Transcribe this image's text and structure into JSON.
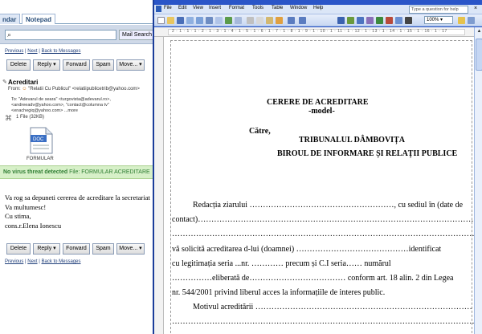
{
  "mail": {
    "tabs": [
      "ndar",
      "Notepad"
    ],
    "search": {
      "placeholder": "",
      "button_label": "Mail Search"
    },
    "links_top": [
      "Previous",
      "Next",
      "Back to Messages"
    ],
    "links_bottom": [
      "Previous",
      "Next",
      "Back to Messages"
    ],
    "actions": [
      "Delete",
      "Reply",
      "Forward",
      "Spam",
      "Move..."
    ],
    "message": {
      "subject": "Acreditari",
      "from_label": "From:",
      "from_value": "\"Relatii Cu Publicul\" <relatiipublicetrib@yahoo.com>",
      "to_label": "To:",
      "to_lines": [
        "\"Adevarul de seara\" <turgovista@adevarul.ro>, ",
        "<andreeadv@yahoo.com>, \"contact@columna tv\" ",
        "<enachegiq@yahoo.com> ...more"
      ],
      "to_more": "more",
      "attachment": "1 File (32KB)",
      "file_label": "FORMULAR",
      "virus_text_bold": "No virus threat detected",
      "virus_text_rest": " File: FORMULAR ACREDITARE",
      "body_lines": [
        "Va rog sa depuneti cererea de acreditare la secretariat",
        "Va multumesc!",
        "Cu stima,",
        "cons.r.Elena Ionescu"
      ]
    }
  },
  "word": {
    "menu": [
      "File",
      "Edit",
      "View",
      "Insert",
      "Format",
      "Tools",
      "Table",
      "Window",
      "Help"
    ],
    "ask_placeholder": "Type a question for help",
    "zoom": "100%",
    "ruler_numbers": "2 · 1 · 1 · 1 · 2 · 1 · 3 · 1 · 4 · 1 · 5 · 1 · 6 · 1 · 7 · 1 · 8 · 1 · 9 · 1 · 10 · 1 · 11 · 1 · 12 · 1 · 13 · 1 · 14 · 1 · 15 · 1 · 16 · 1 · 17",
    "doc": {
      "title": "CERERE DE ACREDITARE",
      "subtitle": "-model-",
      "catre": "Către,",
      "tribunal": "TRIBUNALUL DÂMBOVIȚA",
      "birou": "BIROUL DE INFORMARE ȘI RELAȚII PUBLICE",
      "lines": [
        "Redacția ziarului ………………………………………………, cu sediul în (date de",
        "contact)………………………………………………………………………………………………",
        "……………………………………………………………………………………………………………",
        "vă solicită acreditarea d-lui (doamnei) ……………………………………identificat",
        "cu legitimația seria ...nr. ………… precum și C.I seria…… numărul",
        "……………eliberată de……………………………… conform art. 18 alin. 2 din Legea",
        "nr. 544/2001 privind liberul acces la informațiile de interes public.",
        "Motivul acreditării ………………………………………………………………………",
        "……………………………………………………………………………………………………………"
      ]
    }
  }
}
